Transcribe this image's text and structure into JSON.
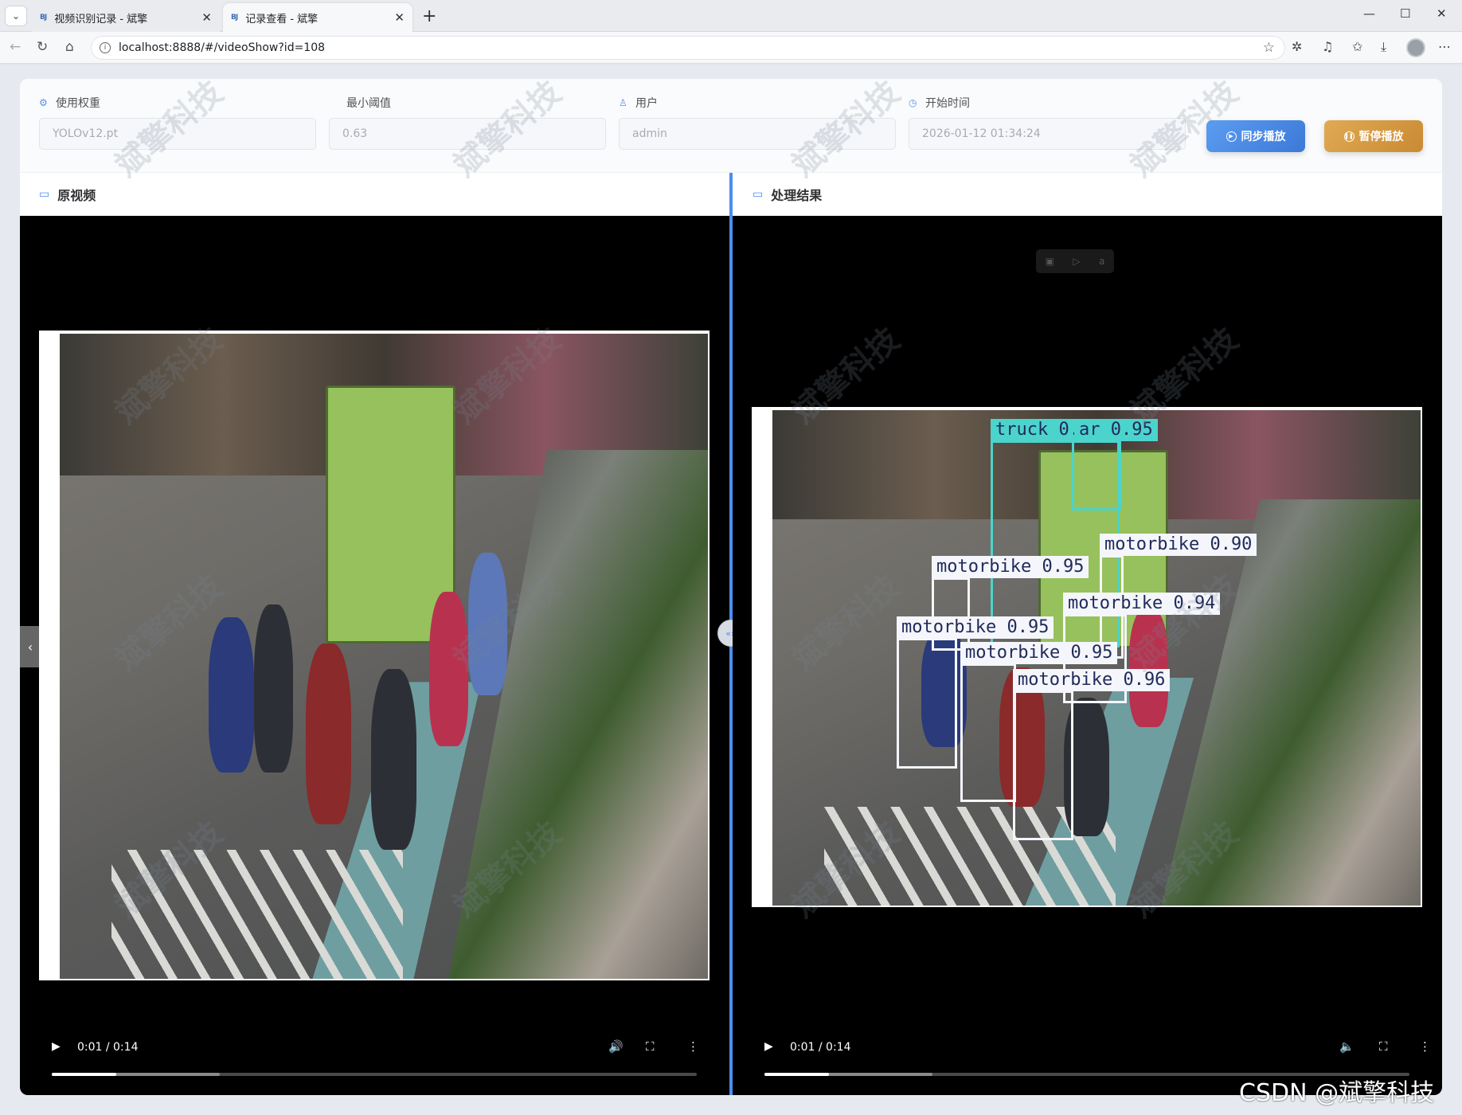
{
  "browser": {
    "tabs": [
      {
        "label": "视频识别记录 - 斌擎",
        "favicon": "BJ"
      },
      {
        "label": "记录查看 - 斌擎",
        "favicon": "BJ"
      }
    ],
    "url": "localhost:8888/#/videoShow?id=108",
    "icons": [
      "back-icon",
      "reload-icon",
      "home-icon",
      "info-icon",
      "star-icon",
      "extensions-icon",
      "music-icon",
      "favorites-icon",
      "download-icon",
      "profile-icon",
      "more-icon"
    ]
  },
  "form": {
    "weights_label": "使用权重",
    "weights_value": "YOLOv12.pt",
    "threshold_label": "最小阈值",
    "threshold_value": "0.63",
    "user_label": "用户",
    "user_value": "admin",
    "start_label": "开始时间",
    "start_value": "2026-01-12 01:34:24",
    "sync_button": "同步播放",
    "pause_button": "暂停播放"
  },
  "left_pane": {
    "title": "原视频",
    "time": "0:01 / 0:14",
    "progress": 0.1,
    "buffered": 0.26
  },
  "right_pane": {
    "title": "处理结果",
    "time": "0:01 / 0:14",
    "progress": 0.1,
    "buffered": 0.26,
    "detections": [
      {
        "label": "truck 0.97",
        "color": "#4bd4cc"
      },
      {
        "label": "ar 0.95",
        "color": "#4bd4cc"
      },
      {
        "label": "motorbike 0.90",
        "color": "#f4f6fb"
      },
      {
        "label": "motorbike 0.95",
        "color": "#f4f6fb"
      },
      {
        "label": "motorbike 0.94",
        "color": "#f4f6fb"
      },
      {
        "label": "motorbike 0.95",
        "color": "#f4f6fb"
      },
      {
        "label": "motorbike 0.95",
        "color": "#f4f6fb"
      },
      {
        "label": "motorbike 0.96",
        "color": "#f4f6fb"
      }
    ]
  },
  "watermark": "斌擎科技",
  "csdn_credit": "CSDN @斌擎科技",
  "colors": {
    "accent": "#4b8ef0",
    "sync": "#3c79d8",
    "pause": "#c98a32"
  }
}
